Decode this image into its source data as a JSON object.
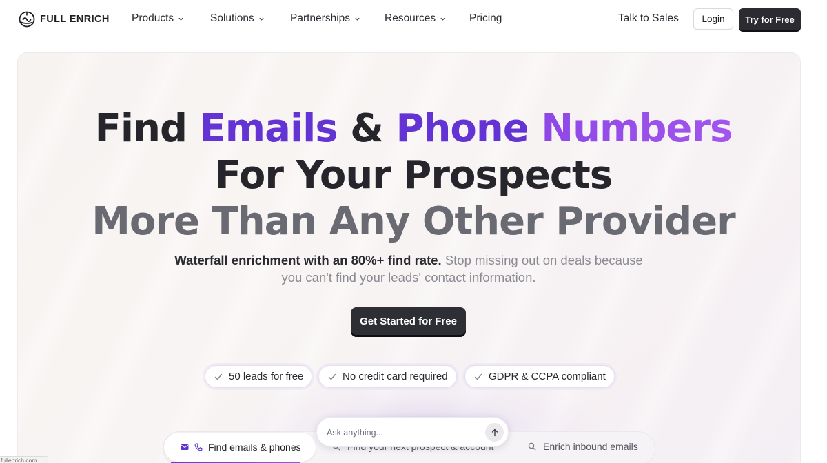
{
  "brand": {
    "name": "FULL ENRICH",
    "logo_icon": "globe-smile-icon"
  },
  "nav": {
    "items": [
      {
        "label": "Products",
        "has_dropdown": true
      },
      {
        "label": "Solutions",
        "has_dropdown": true
      },
      {
        "label": "Partnerships",
        "has_dropdown": true
      },
      {
        "label": "Resources",
        "has_dropdown": true
      },
      {
        "label": "Pricing",
        "has_dropdown": false
      }
    ],
    "talk_to_sales": "Talk to Sales",
    "login": "Login",
    "try_free": "Try for Free"
  },
  "hero": {
    "line1": {
      "find": "Find",
      "emails": "Emails",
      "amp": "&",
      "phone": "Phone",
      "numbers": "Numbers"
    },
    "line2": "For Your Prospects",
    "line3": "More Than Any Other Provider",
    "subtitle_strong": "Waterfall enrichment with an 80%+ find rate.",
    "subtitle_rest_1": "Stop missing out on deals because",
    "subtitle_rest_2": "you can't find your leads' contact information.",
    "cta": "Get Started for Free",
    "badges": [
      "50 leads for free",
      "No credit card required",
      "GDPR & CCPA compliant"
    ],
    "accent_colors": {
      "primary": "#6433d3",
      "secondary": "#a255ee",
      "dark_button": "#2e2e35"
    }
  },
  "bottom": {
    "tabs": [
      {
        "label": "Find emails & phones",
        "active": true,
        "icons": [
          "mail-icon",
          "phone-icon"
        ]
      },
      {
        "label": "Find your next prospect & account",
        "active": false,
        "icon": "search-icon"
      },
      {
        "label": "Enrich inbound emails",
        "active": false,
        "icon": "search-icon"
      }
    ],
    "ask": {
      "placeholder": "Ask anything...",
      "send_icon": "arrow-up-icon"
    }
  },
  "status_url": "fullenrich.com"
}
